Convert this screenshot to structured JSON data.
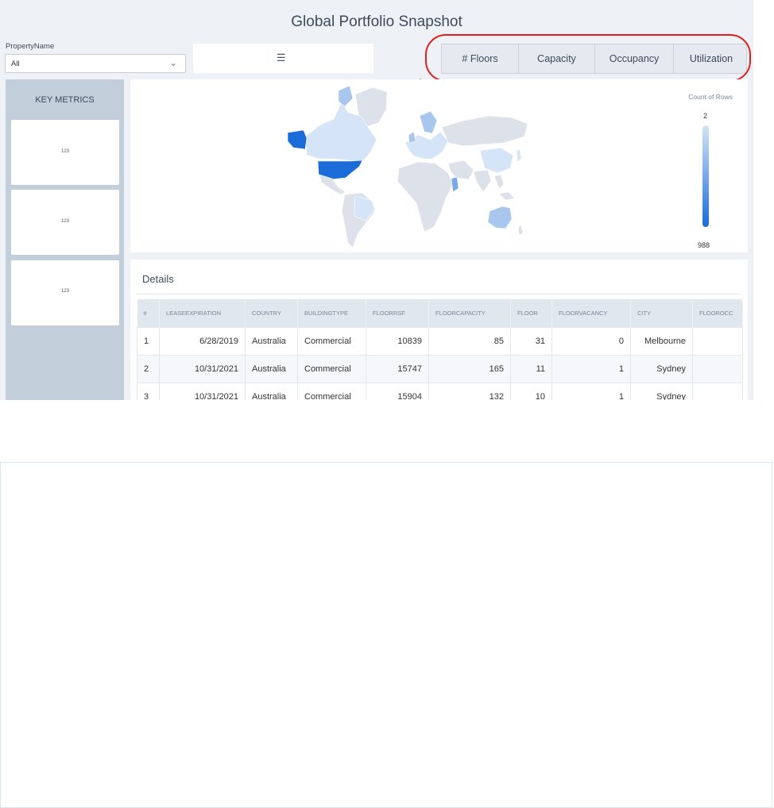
{
  "header": {
    "title": "Global Portfolio Snapshot"
  },
  "filter": {
    "label": "PropertyName",
    "value": "All"
  },
  "list_button": {
    "icon": "list-icon"
  },
  "metric_toggle": {
    "buttons": [
      "# Floors",
      "Capacity",
      "Occupancy",
      "Utilization"
    ]
  },
  "sidebar": {
    "heading": "KEY METRICS",
    "cards": [
      {
        "value": "123"
      },
      {
        "value": "123"
      },
      {
        "value": "123"
      }
    ]
  },
  "map": {
    "legend_title": "Count of Rows",
    "legend_min": "2",
    "legend_max": "988",
    "colors": {
      "max": "#1b6bd8",
      "high": "#7aa8e8",
      "mid": "#a9c6ef",
      "low": "#d5e4f6",
      "none": "#dde2ea"
    }
  },
  "details": {
    "title": "Details",
    "columns": [
      "#",
      "LEASEEXPIRATION",
      "COUNTRY",
      "BUILDINGTYPE",
      "FLOORRSF",
      "FLOORCAPACITY",
      "FLOOR",
      "FLOORVACANCY",
      "CITY",
      "FLOOROCC"
    ],
    "rows": [
      [
        "1",
        "6/28/2019",
        "Australia",
        "Commercial",
        "10839",
        "85",
        "31",
        "0",
        "Melbourne",
        ""
      ],
      [
        "2",
        "10/31/2021",
        "Australia",
        "Commercial",
        "15747",
        "165",
        "11",
        "1",
        "Sydney",
        ""
      ],
      [
        "3",
        "10/31/2021",
        "Australia",
        "Commercial",
        "15904",
        "132",
        "10",
        "1",
        "Sydney",
        ""
      ]
    ]
  }
}
